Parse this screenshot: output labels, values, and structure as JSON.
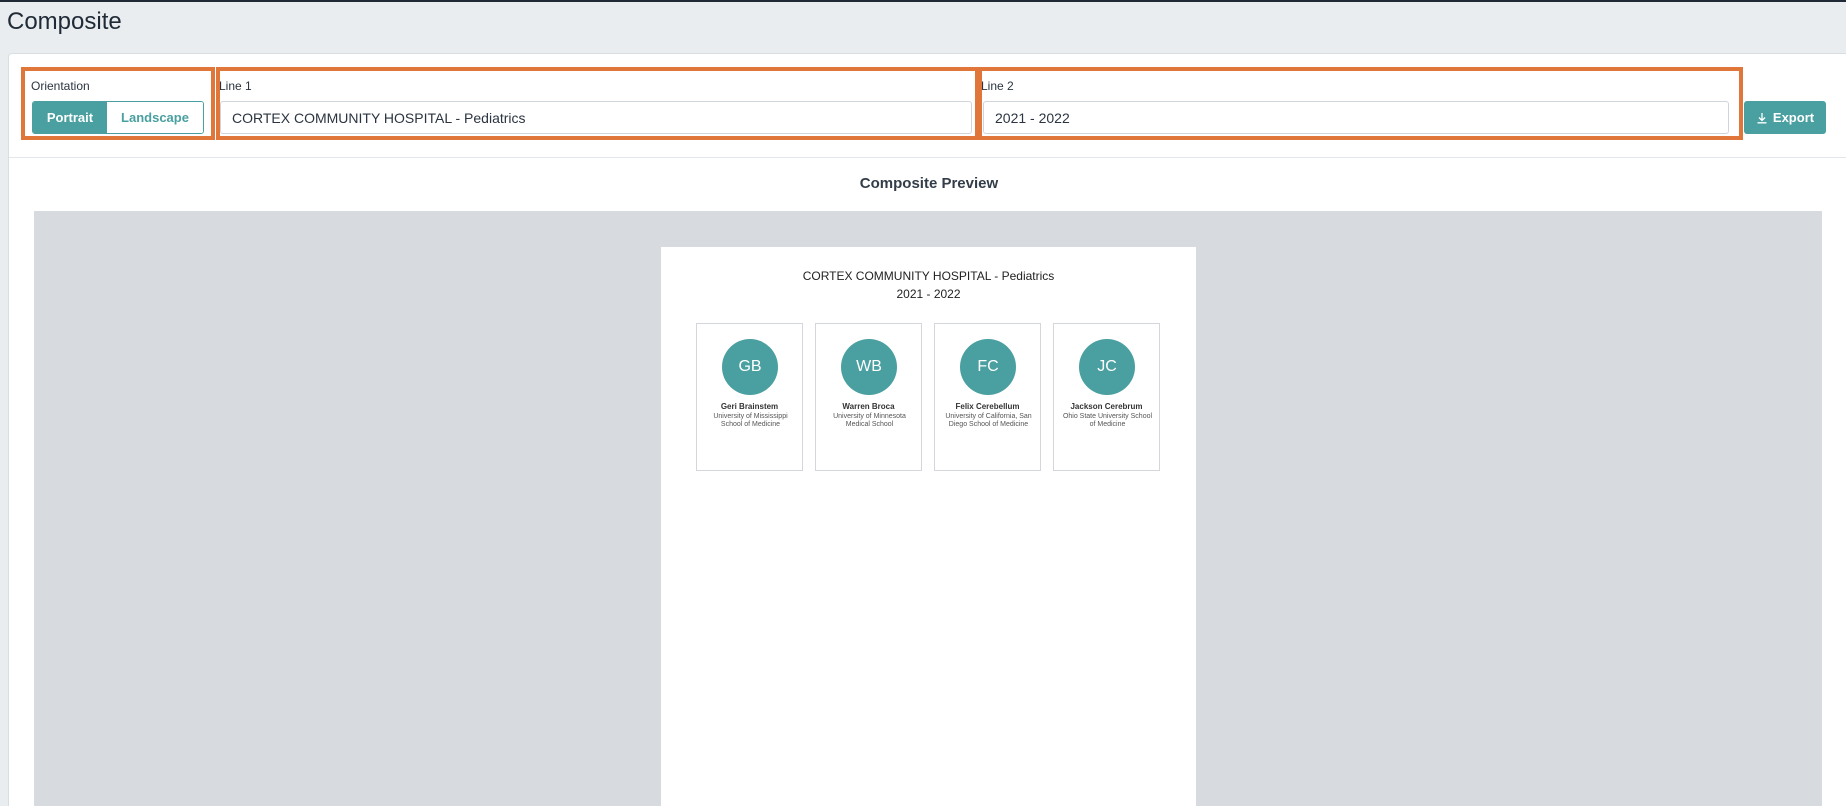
{
  "page": {
    "title": "Composite"
  },
  "controls": {
    "orientation": {
      "label": "Orientation",
      "options": [
        "Portrait",
        "Landscape"
      ],
      "selected": "Portrait"
    },
    "line1": {
      "label": "Line 1",
      "value": "CORTEX COMMUNITY HOSPITAL - Pediatrics"
    },
    "line2": {
      "label": "Line 2",
      "value": "2021 - 2022"
    },
    "export_label": "Export"
  },
  "preview": {
    "title": "Composite Preview",
    "line1": "CORTEX COMMUNITY HOSPITAL - Pediatrics",
    "line2": "2021 - 2022",
    "people": [
      {
        "initials": "GB",
        "name": "Geri Brainstem",
        "school": "University of Mississippi School of Medicine"
      },
      {
        "initials": "WB",
        "name": "Warren Broca",
        "school": "University of Minnesota Medical School"
      },
      {
        "initials": "FC",
        "name": "Felix Cerebellum",
        "school": "University of California, San Diego School of Medicine"
      },
      {
        "initials": "JC",
        "name": "Jackson Cerebrum",
        "school": "Ohio State University School of Medicine"
      }
    ]
  },
  "colors": {
    "accent": "#4a9fa0",
    "highlight": "#e0763a",
    "preview_bg": "#d7dade"
  }
}
